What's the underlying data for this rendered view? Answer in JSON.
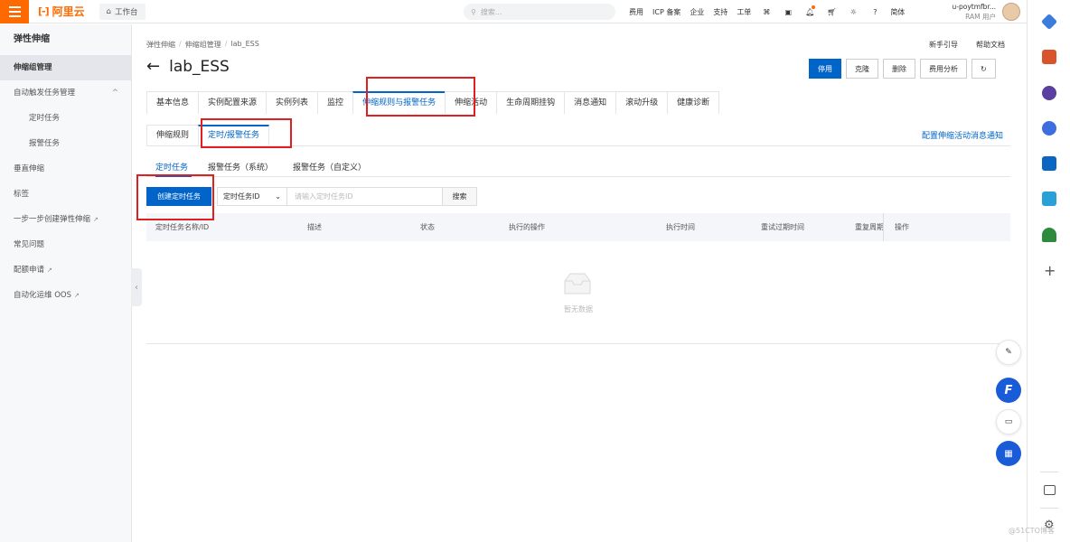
{
  "topbar": {
    "brand": "阿里云",
    "workbench": "工作台",
    "search_placeholder": "搜索...",
    "nav": [
      "费用",
      "ICP 备案",
      "企业",
      "支持",
      "工单"
    ],
    "lang": "简体",
    "user_name": "u-poytmfbr...",
    "user_role": "RAM 用户"
  },
  "sidebar": {
    "title": "弹性伸缩",
    "items": [
      {
        "label": "伸缩组管理",
        "active": true
      },
      {
        "label": "自动触发任务管理",
        "active": false
      },
      {
        "label": "定时任务",
        "active": false
      },
      {
        "label": "报警任务",
        "active": false
      },
      {
        "label": "垂直伸缩",
        "active": false
      },
      {
        "label": "标签",
        "active": false
      },
      {
        "label": "一步一步创建弹性伸缩",
        "active": false
      },
      {
        "label": "常见问题",
        "active": false
      },
      {
        "label": "配额申请",
        "active": false
      },
      {
        "label": "自动化运维 OOS",
        "active": false
      }
    ]
  },
  "breadcrumb": [
    "弹性伸缩",
    "伸缩组管理",
    "lab_ESS"
  ],
  "top_links": [
    "新手引导",
    "帮助文档"
  ],
  "page_title": "lab_ESS",
  "actions": [
    "停用",
    "克隆",
    "删除",
    "费用分析"
  ],
  "main_tabs": [
    "基本信息",
    "实例配置来源",
    "实例列表",
    "监控",
    "伸缩规则与报警任务",
    "伸缩活动",
    "生命周期挂钩",
    "消息通知",
    "滚动升级",
    "健康诊断"
  ],
  "sub_tabs": [
    "伸缩规则",
    "定时/报警任务"
  ],
  "config_link": "配置伸缩活动消息通知",
  "task_tabs": [
    "定时任务",
    "报警任务（系统）",
    "报警任务（自定义）"
  ],
  "toolbar": {
    "create_label": "创建定时任务",
    "select_value": "定时任务ID",
    "input_placeholder": "请输入定时任务ID",
    "search_label": "搜索"
  },
  "table": {
    "columns": [
      "定时任务名称/ID",
      "描述",
      "状态",
      "执行的操作",
      "执行时间",
      "重试过期时间",
      "重复周期",
      "操作"
    ],
    "empty_text": "暂无数据"
  },
  "watermark": "@51CTO博客",
  "colors": {
    "brand": "#ff6a00",
    "primary": "#0064c8",
    "highlight": "#e02020"
  }
}
